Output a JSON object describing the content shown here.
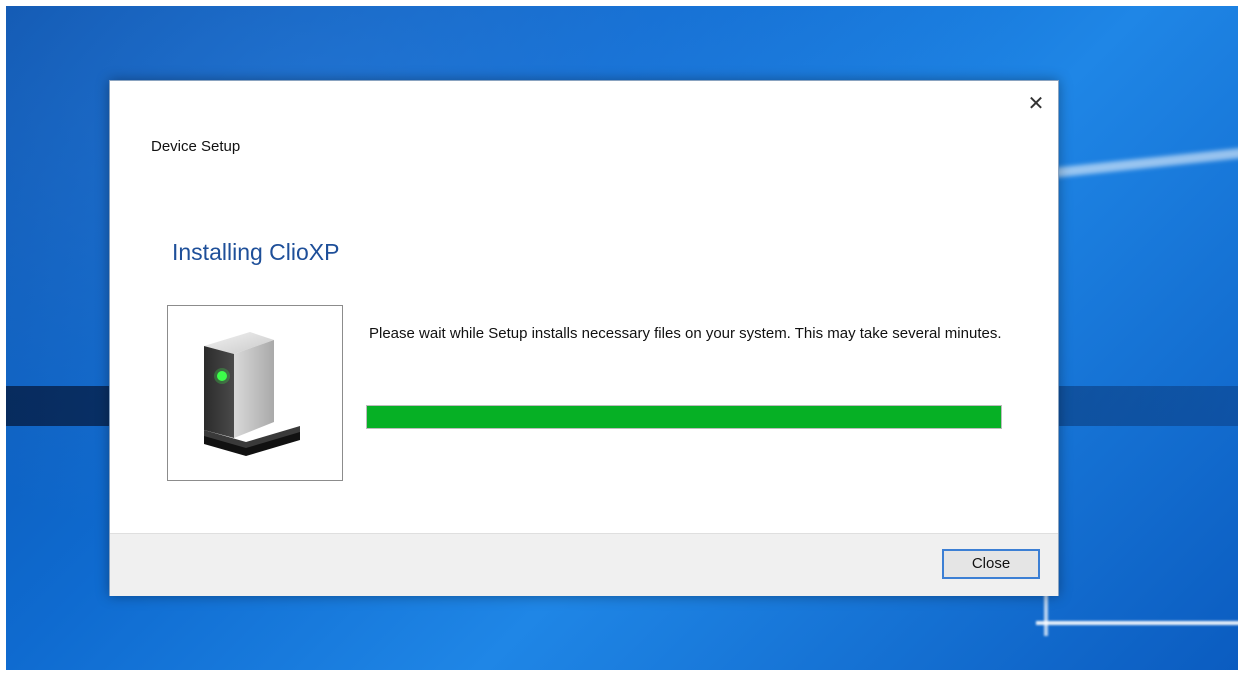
{
  "dialog": {
    "title": "Device Setup",
    "heading": "Installing ClioXP",
    "message": "Please wait while Setup installs necessary files on your system. This may take several minutes.",
    "close_x": "✕",
    "close_button_label": "Close",
    "progress_fraction": 1.0,
    "device_icon": "external-drive-icon"
  },
  "colors": {
    "heading": "#1e4f99",
    "progress": "#06b025",
    "button_border": "#3c7fd4"
  }
}
